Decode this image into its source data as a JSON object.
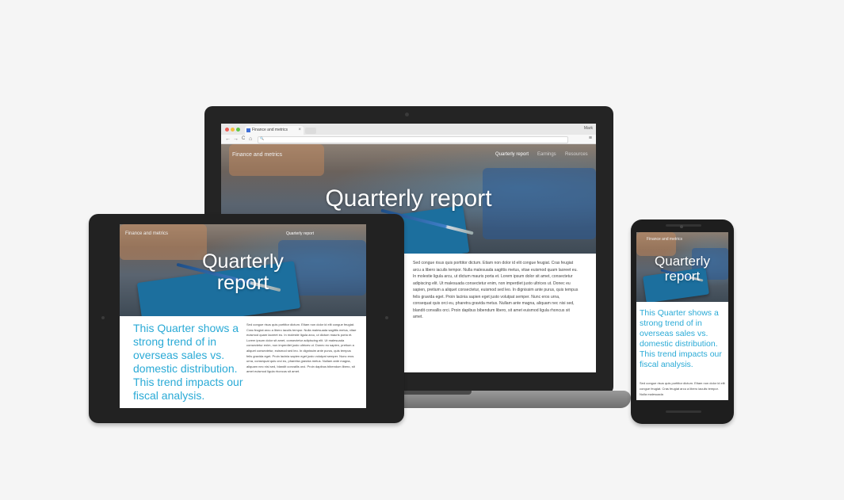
{
  "browser": {
    "tab_title": "Finance and metrics",
    "tab_close": "×",
    "window_user": "Mark",
    "nav_back": "←",
    "nav_forward": "→",
    "nav_reload": "C",
    "nav_home": "⌂",
    "address_icon": "🔍",
    "menu_icon": "≡"
  },
  "site": {
    "name": "Finance and metrics",
    "nav": [
      "Quarterly report",
      "Earnings",
      "Resources"
    ],
    "hero_title": "Quarterly report",
    "hero_title_line1": "Quarterly",
    "hero_title_line2": "report",
    "pull_quote": "This Quarter shows a strong trend of in overseas sales vs. domestic distribution. This trend impacts our fiscal analysis.",
    "body_text": "Sed congue risus quis porttitor dictum. Etiam non dolor id elit congue feugiat. Cras feugiat arcu a libero iaculis tempor. Nulla malesuada sagittis metus, vitae euismod quam laoreet eu. In molestie ligula arcu, ut dictum mauris porta et. Lorem ipsum dolor sit amet, consectetur adipiscing elit. Ut malesuada consectetur enim, non imperdiet justo ultrices ut. Donec eu sapien, pretium a aliquet consectetur, euismod sed leo. In dignissim ante purus, quis tempus felis gravida eget. Proin lacinia sapien eget justo volutpat semper. Nunc eros urna, consequat quis orci eu, pharetra gravida metus. Nullam ante magna, aliquam nec nisi sed, blandit convallis orci. Proin dapibus bibendum libero, sit amet euismod ligula rhoncus sit amet.",
    "phone_body_text": "Sed congue risus quis porttitor dictum. Etiam non dolor id elit congue feugiat. Cras feugiat arcu a libero iaculis tempor. Nulla malesuada"
  },
  "colors": {
    "accent": "#2aaad6",
    "page_background": "#f5f5f5",
    "device_frame": "#222222",
    "notebook": "#1c6f9e"
  }
}
